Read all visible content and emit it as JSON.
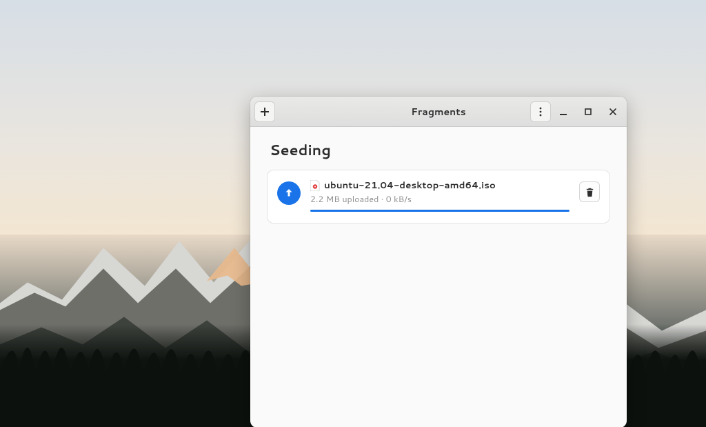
{
  "window": {
    "title": "Fragments"
  },
  "section": {
    "heading": "Seeding"
  },
  "torrent": {
    "filename": "ubuntu-21.04-desktop-amd64.iso",
    "status": "2.2 MB uploaded · 0 kB/s"
  }
}
